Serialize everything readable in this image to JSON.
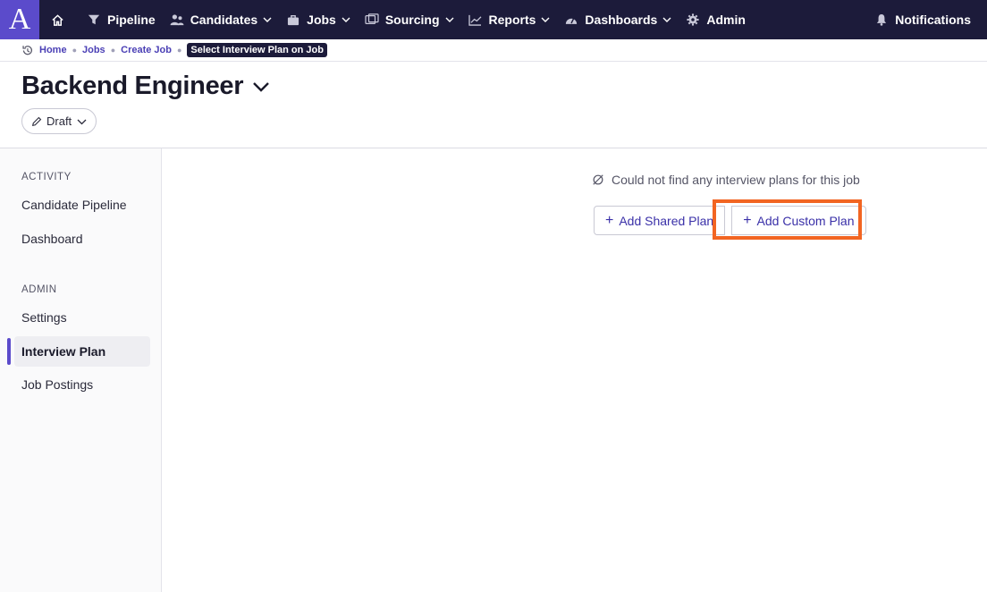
{
  "app": {
    "logo_letter": "A",
    "accent_color": "#5b4bcb",
    "nav_bg": "#1c1b3a",
    "highlight_color": "#f26522"
  },
  "nav": {
    "home_icon": "home-icon",
    "items": [
      {
        "label": "Pipeline",
        "icon": "filter-icon"
      },
      {
        "label": "Candidates",
        "icon": "people-icon"
      },
      {
        "label": "Jobs",
        "icon": "briefcase-icon"
      },
      {
        "label": "Sourcing",
        "icon": "sourcing-icon"
      },
      {
        "label": "Reports",
        "icon": "chart-line-icon"
      },
      {
        "label": "Dashboards",
        "icon": "gauge-icon"
      },
      {
        "label": "Admin",
        "icon": "gear-icon"
      }
    ],
    "notifications_label": "Notifications"
  },
  "breadcrumb": {
    "items": [
      "Home",
      "Jobs",
      "Create Job"
    ],
    "current": "Select Interview Plan on Job"
  },
  "header": {
    "title": "Backend Engineer",
    "status_label": "Draft"
  },
  "sidebar": {
    "activity_label": "ACTIVITY",
    "activity_items": [
      "Candidate Pipeline",
      "Dashboard"
    ],
    "admin_label": "ADMIN",
    "admin_items": [
      "Settings",
      "Interview Plan",
      "Job Postings"
    ],
    "active_item": "Interview Plan"
  },
  "main": {
    "empty_message": "Could not find any interview plans for this job",
    "add_shared_label": "Add Shared Plan",
    "add_custom_label": "Add Custom Plan"
  }
}
